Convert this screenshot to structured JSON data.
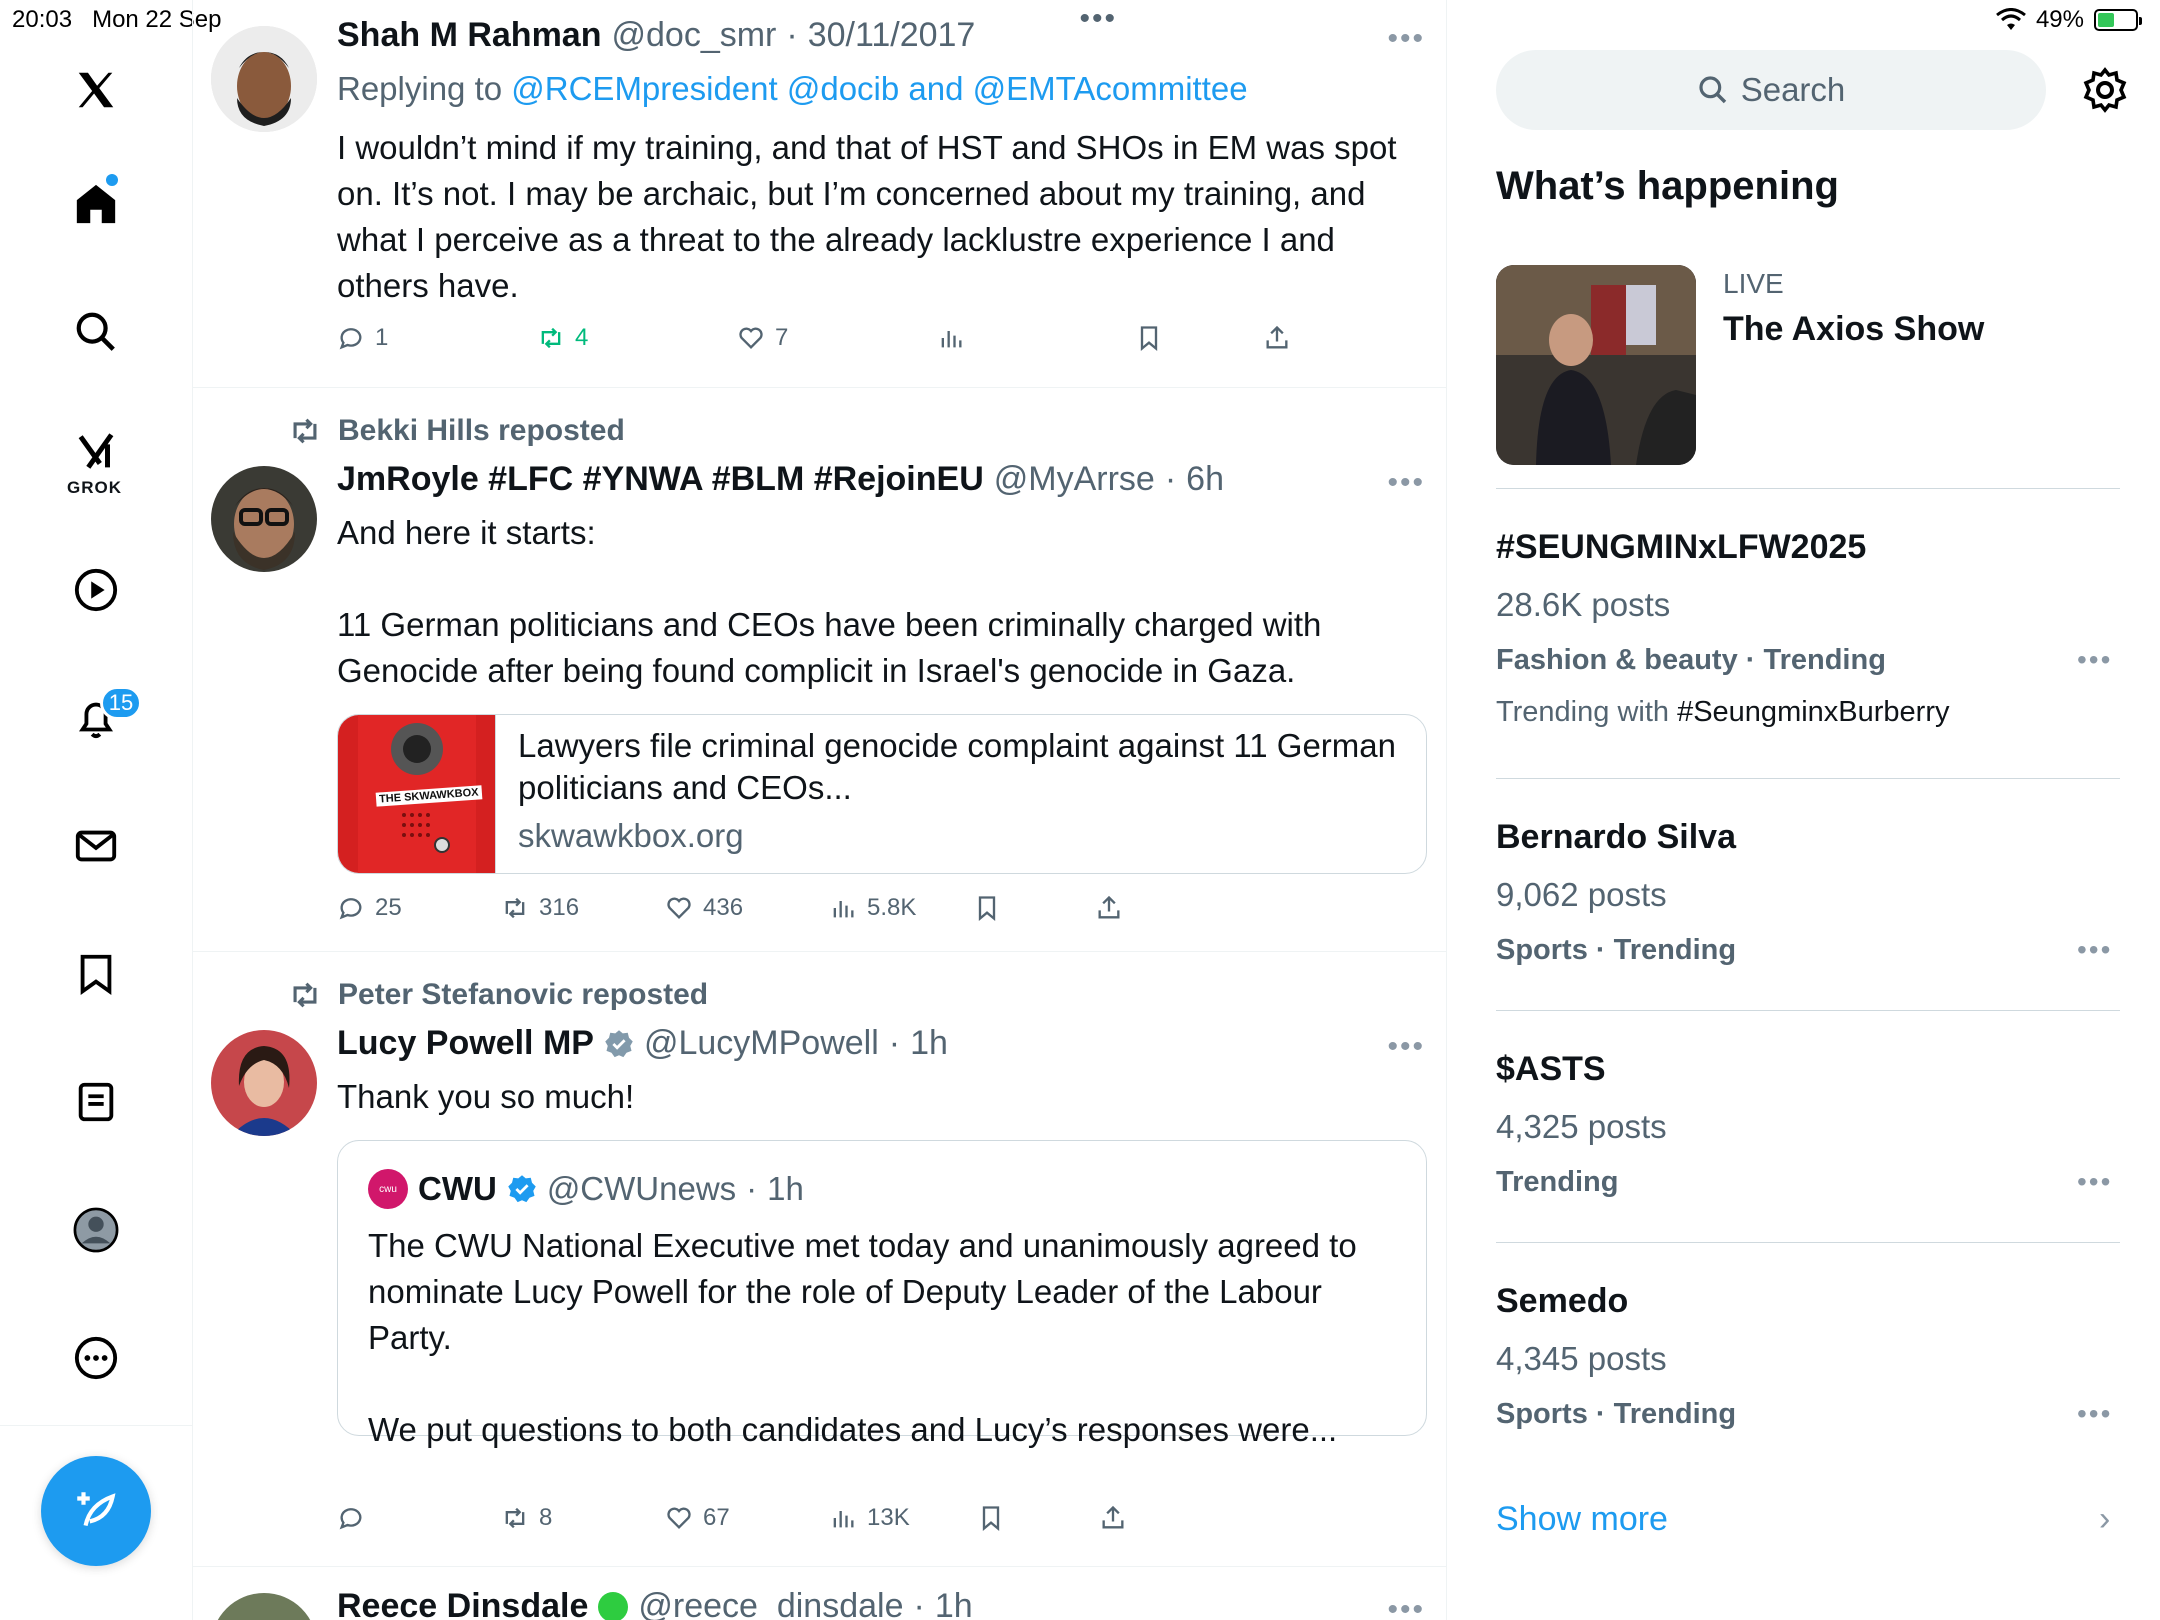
{
  "status_bar": {
    "time": "20:03",
    "date": "Mon 22 Sep",
    "battery": "49%",
    "battery_level": 0.49
  },
  "nav": {
    "grok_label": "GROK",
    "notifications_badge": "15",
    "icons": [
      "x-logo-icon",
      "home-icon",
      "search-icon",
      "grok-icon",
      "video-icon",
      "bell-icon",
      "mail-icon",
      "bookmark-icon",
      "lists-icon",
      "profile-icon",
      "more-icon",
      "compose-icon"
    ]
  },
  "feed": {
    "posts": [
      {
        "name": "Shah M Rahman",
        "handle": "@doc_smr",
        "time": "30/11/2017",
        "replying_prefix": "Replying to ",
        "replying_to": "@RCEMpresident @docib and @EMTAcommittee",
        "text": "I wouldn’t mind if my training, and that of HST and SHOs in EM was spot on. It’s not. I may be archaic, but I’m concerned about my training, and what I perceive as a threat to the already lacklustre experience I and others have.",
        "replies": "1",
        "reposts": "4",
        "likes": "7"
      },
      {
        "reposted_by": "Bekki Hills reposted",
        "name": "JmRoyle #LFC #YNWA #BLM #RejoinEU",
        "handle": "@MyArrse",
        "time": "6h",
        "text": "And here it starts:\n\n11 German politicians and CEOs have been criminally charged with Genocide after being found complicit in Israel's genocide in Gaza.",
        "card_title": "Lawyers file criminal genocide complaint against 11 German politicians and CEOs...",
        "card_domain": "skwawkbox.org",
        "card_logo_text": "THE SKWAWKBOX",
        "replies": "25",
        "reposts": "316",
        "likes": "436",
        "views": "5.8K"
      },
      {
        "reposted_by": "Peter Stefanovic reposted",
        "name": "Lucy Powell MP",
        "handle": "@LucyMPowell",
        "time": "1h",
        "text": "Thank you so much!",
        "quote": {
          "name": "CWU",
          "handle": "@CWUnews",
          "time": "1h",
          "logo_text": "cwu",
          "text": "The CWU National Executive met today and unanimously agreed to nominate Lucy Powell for the role of Deputy Leader of the Labour Party.\n\nWe put questions to both candidates and Lucy’s responses were..."
        },
        "reposts": "8",
        "likes": "67",
        "views": "13K"
      },
      {
        "name": "Reece Dinsdale",
        "handle": "@reece_dinsdale",
        "time": "1h"
      }
    ]
  },
  "sidebar": {
    "search_placeholder": "Search",
    "title": "What’s happening",
    "live": {
      "label": "LIVE",
      "title": "The Axios Show"
    },
    "trends": [
      {
        "name": "#SEUNGMINxLFW2025",
        "count": "28.6K posts",
        "category": "Fashion & beauty · Trending",
        "with_prefix": "Trending with ",
        "with_tag": "#SeungminxBurberry"
      },
      {
        "name": "Bernardo Silva",
        "count": "9,062 posts",
        "category": "Sports · Trending"
      },
      {
        "name": "$ASTS",
        "count": "4,325 posts",
        "category": "Trending"
      },
      {
        "name": "Semedo",
        "count": "4,345 posts",
        "category": "Sports · Trending"
      }
    ],
    "show_more": "Show more"
  },
  "colors": {
    "accent": "#1d9bf0",
    "text": "#0f1419",
    "secondary": "#536471",
    "repost_green": "#00ba7c"
  }
}
